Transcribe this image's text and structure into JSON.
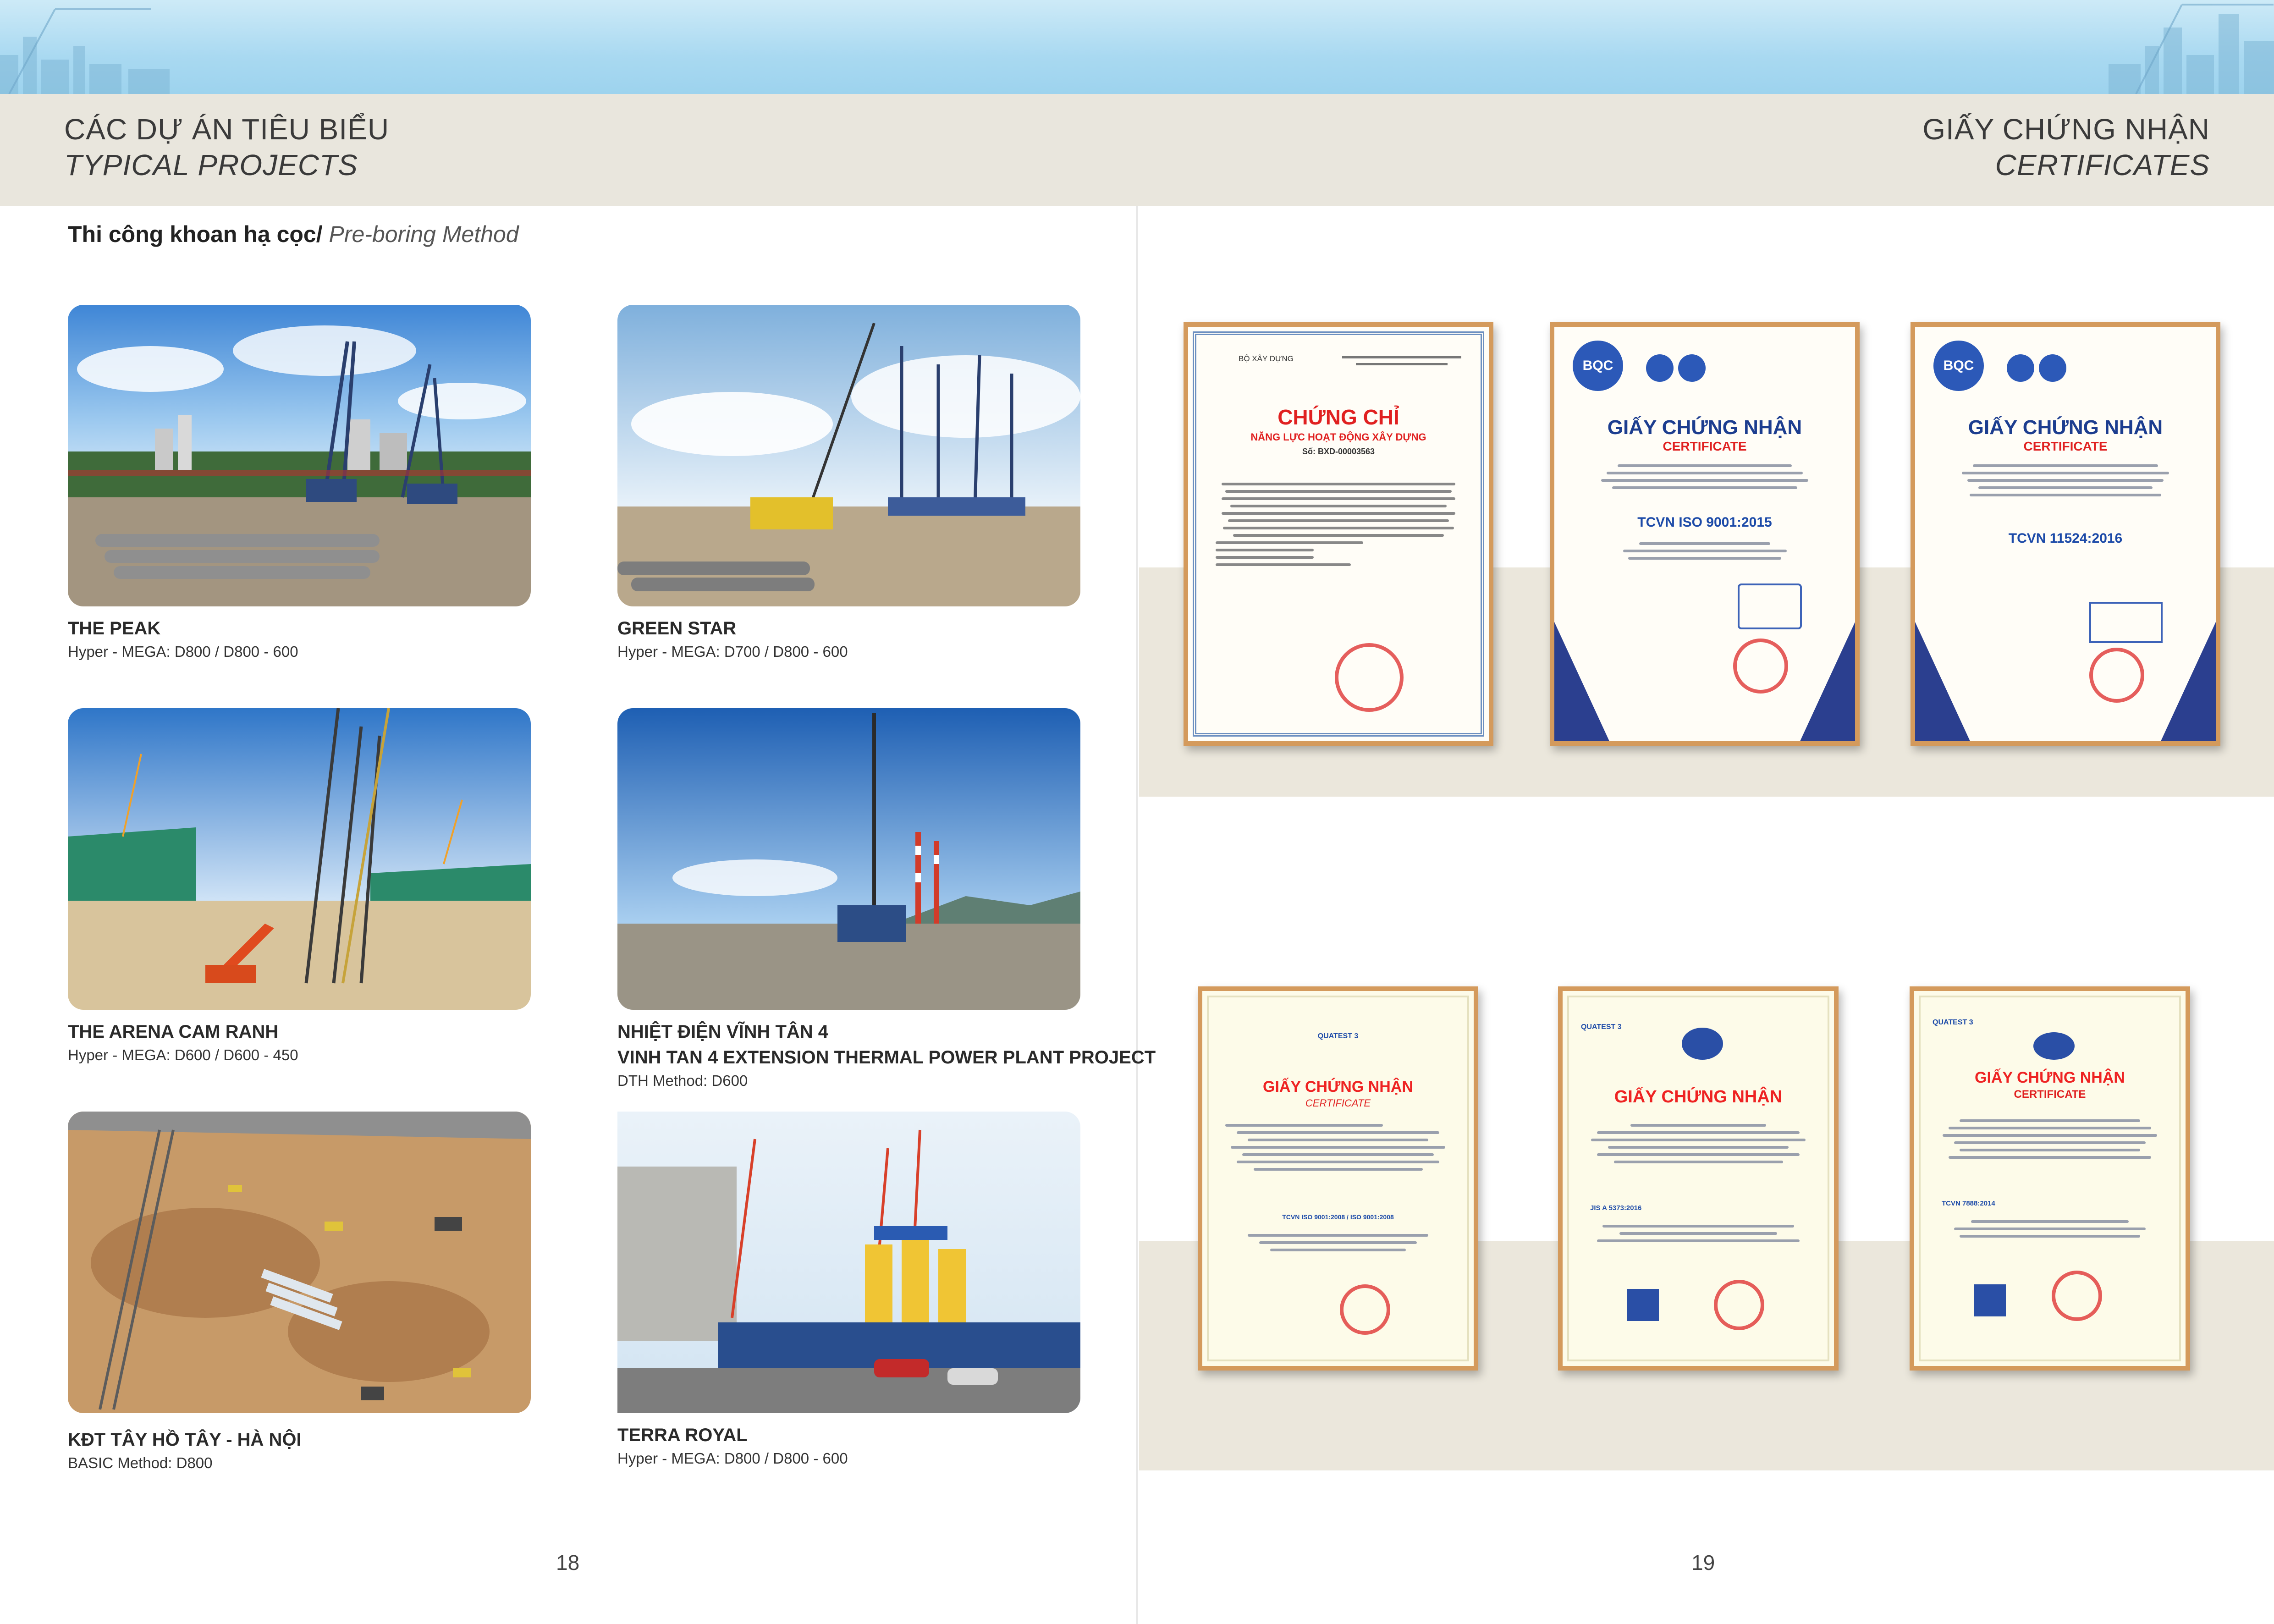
{
  "header": {
    "left_vn": "CÁC DỰ ÁN TIÊU BIỂU",
    "left_en": "TYPICAL PROJECTS",
    "right_vn": "GIẤY CHỨNG NHẬN",
    "right_en": "CERTIFICATES"
  },
  "section": {
    "title_vn": "Thi công khoan hạ cọc/",
    "title_en": " Pre-boring Method"
  },
  "projects": [
    {
      "name": "THE PEAK",
      "method": "Hyper - MEGA: D800 / D800 - 600"
    },
    {
      "name": "GREEN STAR",
      "method": "Hyper - MEGA: D700 / D800 - 600"
    },
    {
      "name": "THE ARENA CAM RANH",
      "method": "Hyper - MEGA: D600 / D600 - 450"
    },
    {
      "name": "NHIỆT ĐIỆN VĨNH TÂN 4",
      "name2": "VINH TAN 4 EXTENSION THERMAL POWER PLANT PROJECT",
      "method": "DTH Method: D600"
    },
    {
      "name": "KĐT TÂY HỒ TÂY - HÀ NỘI",
      "method": "BASIC Method: D800"
    },
    {
      "name": "TERRA ROYAL",
      "method": "Hyper - MEGA: D800 / D800 - 600"
    }
  ],
  "certificates": [
    {
      "title": "CHỨNG CHỈ",
      "subtitle": "NĂNG LỰC HOẠT ĐỘNG XÂY DỰNG",
      "org": "BỘ XÂY DỰNG",
      "number": "Số: BXD-00003563"
    },
    {
      "title": "GIẤY CHỨNG NHẬN",
      "subtitle": "CERTIFICATE",
      "org": "BQC",
      "standard": "TCVN ISO 9001:2015"
    },
    {
      "title": "GIẤY CHỨNG NHẬN",
      "subtitle": "CERTIFICATE",
      "org": "BQC",
      "standard": "TCVN 11524:2016"
    },
    {
      "title": "GIẤY CHỨNG NHẬN",
      "subtitle": "CERTIFICATE",
      "org": "QUATEST 3",
      "standard": "TCVN ISO 9001:2008 / ISO 9001:2008"
    },
    {
      "title": "GIẤY CHỨNG NHẬN",
      "subtitle": "",
      "org": "QUATEST 3",
      "standard": "JIS A 5373:2016"
    },
    {
      "title": "GIẤY CHỨNG NHẬN",
      "subtitle": "CERTIFICATE",
      "org": "QUATEST 3",
      "standard": "TCVN 7888:2014"
    }
  ],
  "pages": {
    "left": "18",
    "right": "19"
  },
  "colors": {
    "title_band": "#e9e6dd",
    "cert_frame": "#d49a5c",
    "cert_red": "#e02020",
    "sky": "#a9d9f1"
  }
}
